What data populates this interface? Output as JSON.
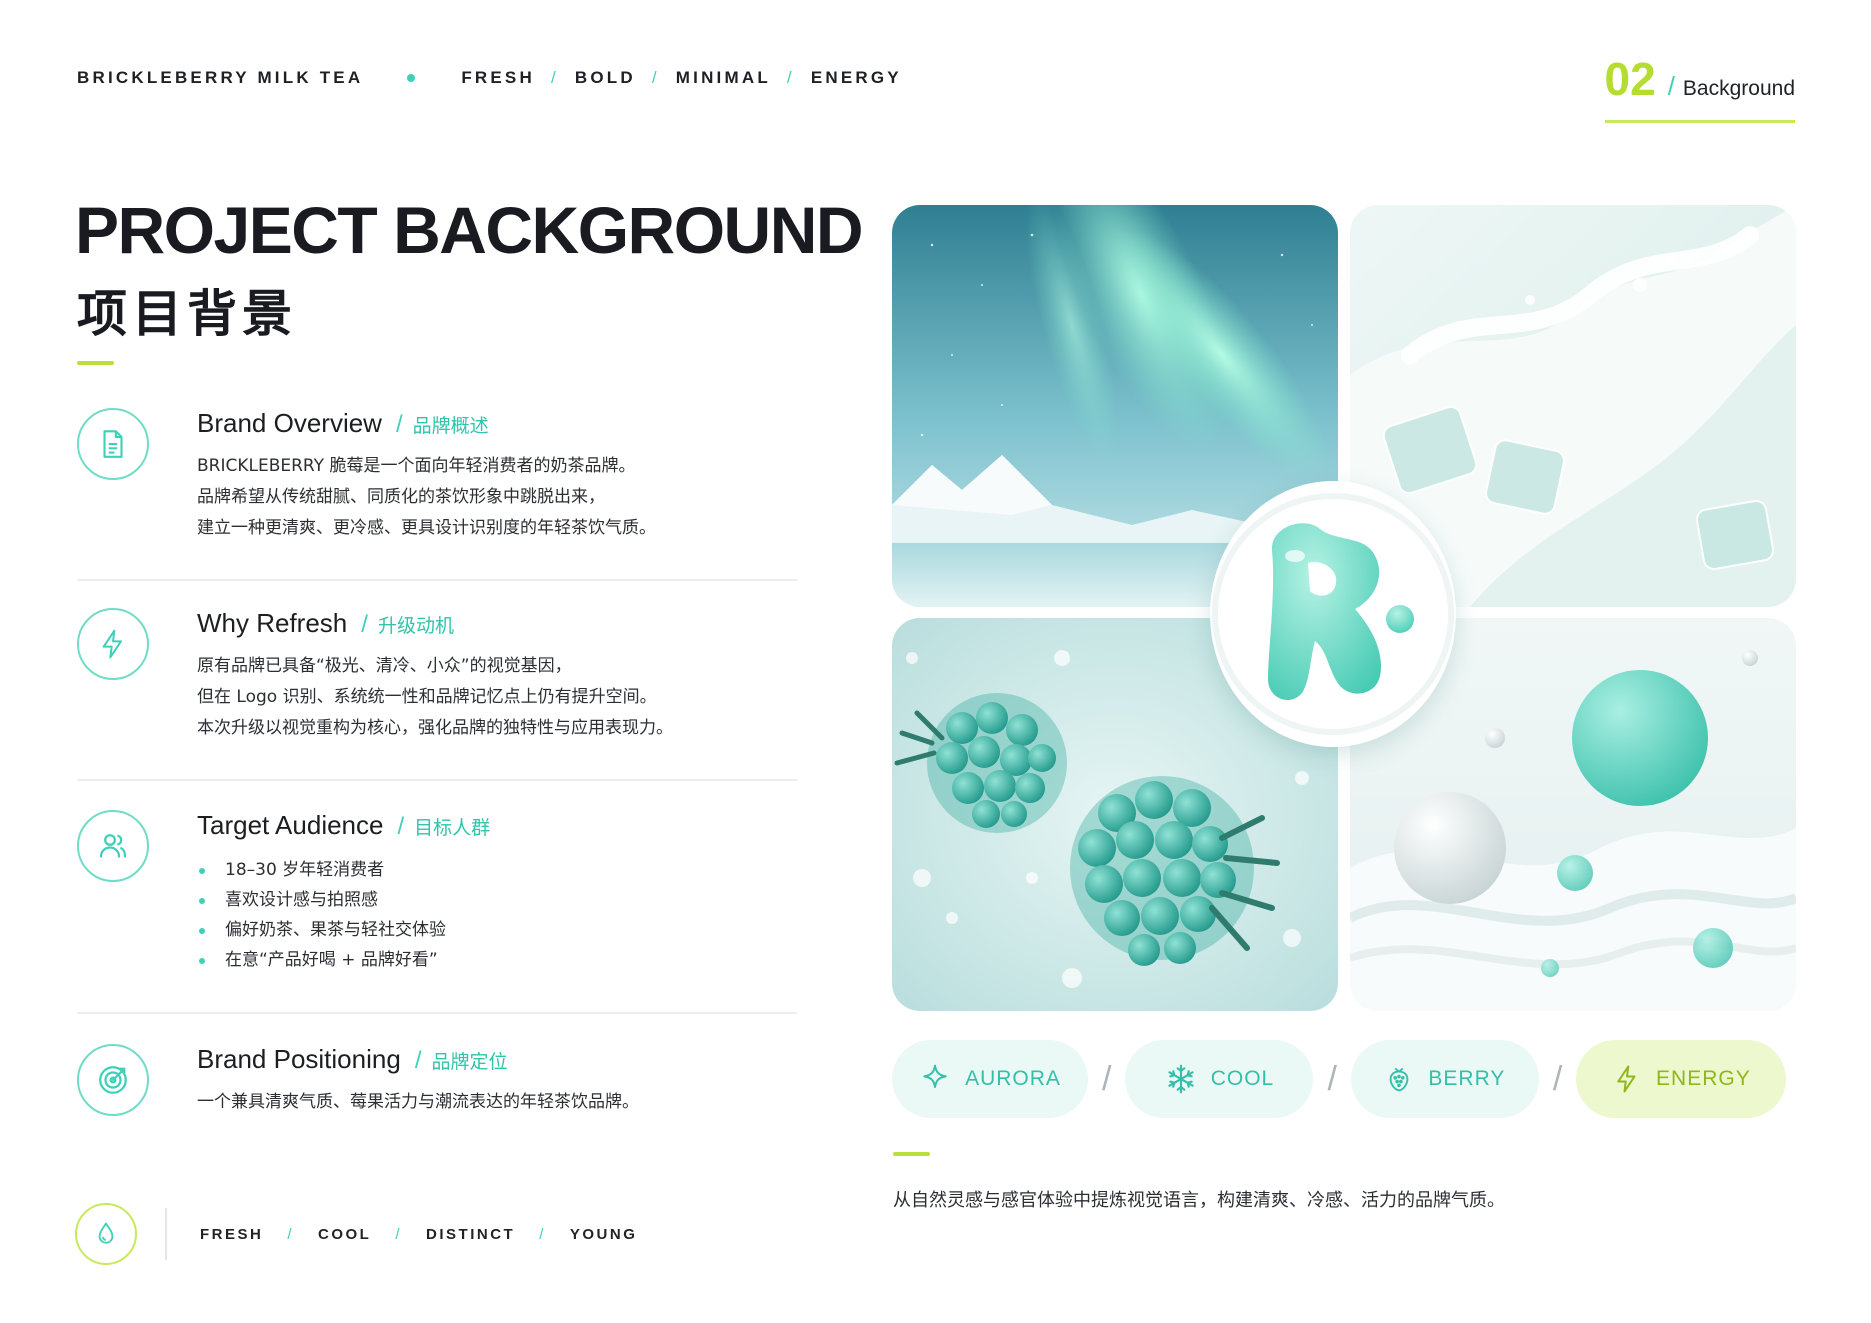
{
  "header": {
    "brand": "BRICKLEBERRY MILK TEA",
    "keywords": [
      "FRESH",
      "BOLD",
      "MINIMAL",
      "ENERGY"
    ],
    "page_number": "02",
    "page_label": "Background"
  },
  "title": {
    "en": "PROJECT BACKGROUND",
    "cn": "项目背景"
  },
  "sections": [
    {
      "title": "Brand Overview",
      "title_cn": "品牌概述",
      "icon": "document-icon",
      "lines": [
        "BRICKLEBERRY 脆莓是一个面向年轻消费者的奶茶品牌。",
        "品牌希望从传统甜腻、同质化的茶饮形象中跳脱出来，",
        "建立一种更清爽、更冷感、更具设计识别度的年轻茶饮气质。"
      ]
    },
    {
      "title": "Why Refresh",
      "title_cn": "升级动机",
      "icon": "lightning-icon",
      "lines": [
        "原有品牌已具备“极光、清冷、小众”的视觉基因，",
        "但在 Logo 识别、系统统一性和品牌记忆点上仍有提升空间。",
        "本次升级以视觉重构为核心，强化品牌的独特性与应用表现力。"
      ]
    },
    {
      "title": "Target Audience",
      "title_cn": "目标人群",
      "icon": "users-icon",
      "bullets": [
        "18–30 岁年轻消费者",
        "喜欢设计感与拍照感",
        "偏好奶茶、果茶与轻社交体验",
        "在意“产品好喝 + 品牌好看”"
      ]
    },
    {
      "title": "Brand Positioning",
      "title_cn": "品牌定位",
      "icon": "target-icon",
      "lines": [
        "一个兼具清爽气质、莓果活力与潮流表达的年轻茶饮品牌。"
      ]
    }
  ],
  "footer": {
    "icon": "water-drop-icon",
    "words": [
      "FRESH",
      "COOL",
      "DISTINCT",
      "YOUNG"
    ]
  },
  "moodboard": {
    "images": [
      "aurora-image",
      "milk-splash-image",
      "berry-image",
      "milk-wave-image"
    ],
    "logo": "brand-logo-r"
  },
  "pills": [
    {
      "label": "AURORA",
      "icon": "sparkle-icon"
    },
    {
      "label": "COOL",
      "icon": "snowflake-icon"
    },
    {
      "label": "BERRY",
      "icon": "berry-icon"
    },
    {
      "label": "ENERGY",
      "icon": "lightning-icon"
    }
  ],
  "tagline": "从自然灵感与感官体验中提炼视觉语言，构建清爽、冷感、活力的品牌气质。",
  "colors": {
    "mint": "#3ed1b8",
    "lime": "#b5dd2f",
    "text": "#1b1d22"
  }
}
